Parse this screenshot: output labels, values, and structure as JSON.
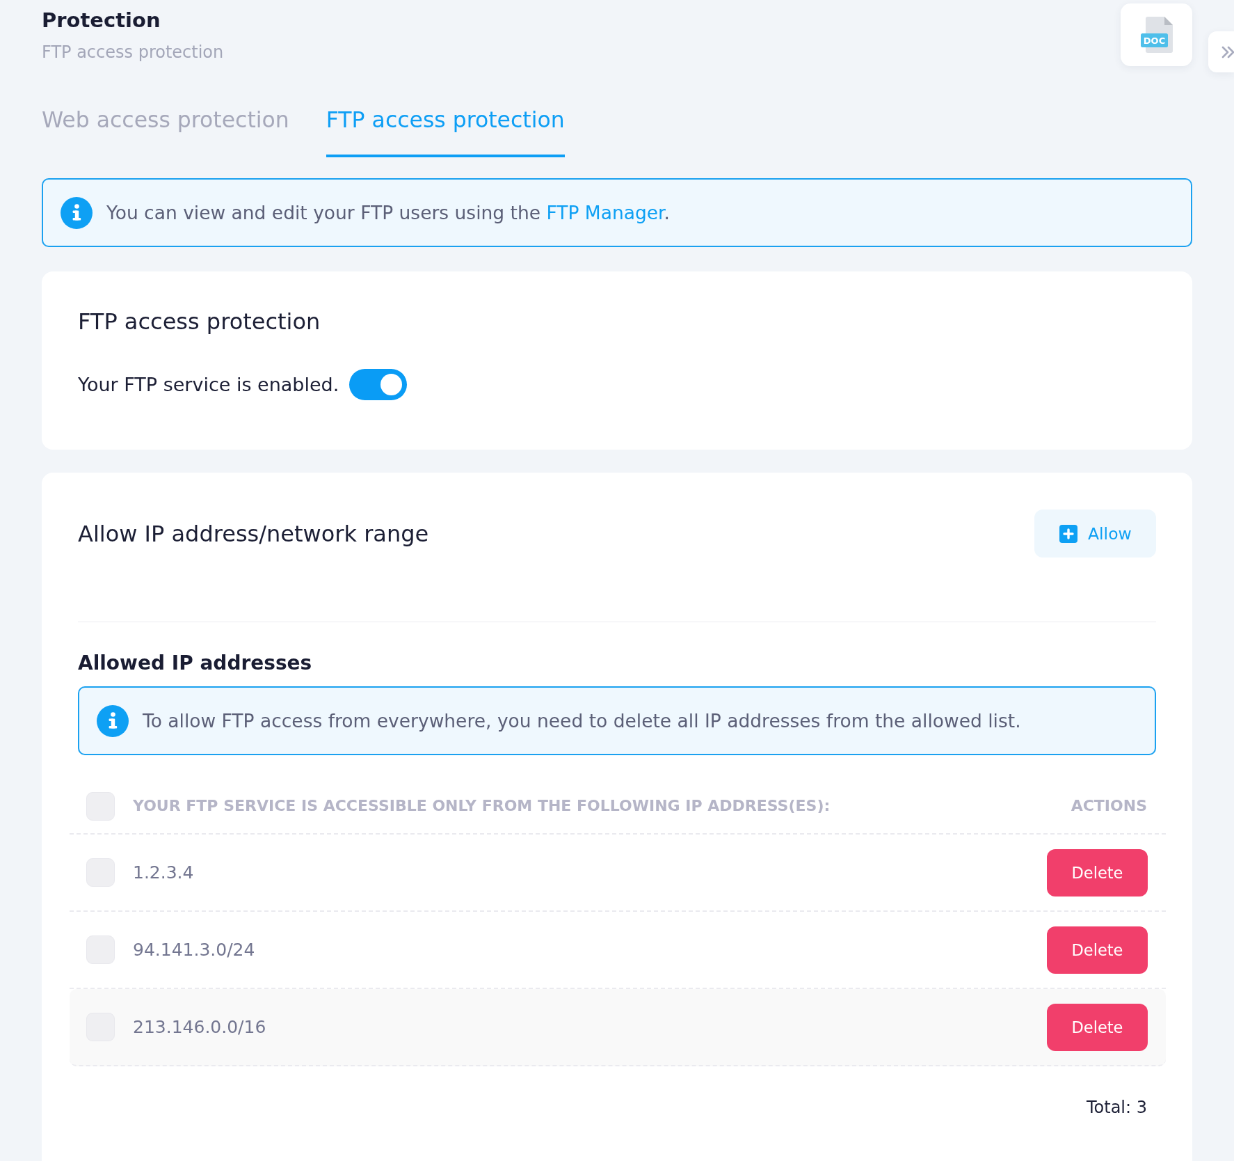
{
  "page": {
    "title": "Protection",
    "subtitle": "FTP access protection"
  },
  "doc_button": {
    "label": "DOC"
  },
  "tabs": [
    {
      "label": "Web access protection",
      "selected": false
    },
    {
      "label": "FTP access protection",
      "selected": true
    }
  ],
  "notice": {
    "text": "You can view and edit your FTP users using the ",
    "link": "FTP Manager",
    "after": "."
  },
  "service_card": {
    "title": "FTP access protection",
    "status_text": "Your FTP service is enabled.",
    "toggle_on": true
  },
  "allow_card": {
    "title": "Allow IP address/network range",
    "allow_button": "Allow",
    "list_title": "Allowed IP addresses",
    "notice": "To allow FTP access from everywhere, you need to delete all IP addresses from the allowed list.",
    "table": {
      "select_all_checked": false,
      "columns": [
        "YOUR FTP SERVICE IS ACCESSIBLE ONLY FROM THE FOLLOWING IP ADDRESS(ES):",
        "ACTIONS"
      ],
      "rows": [
        {
          "ip": "1.2.3.4",
          "checked": false,
          "highlighted": false,
          "action": "Delete"
        },
        {
          "ip": "94.141.3.0/24",
          "checked": false,
          "highlighted": false,
          "action": "Delete"
        },
        {
          "ip": "213.146.0.0/16",
          "checked": false,
          "highlighted": true,
          "action": "Delete"
        }
      ]
    },
    "total": "Total: 3"
  }
}
